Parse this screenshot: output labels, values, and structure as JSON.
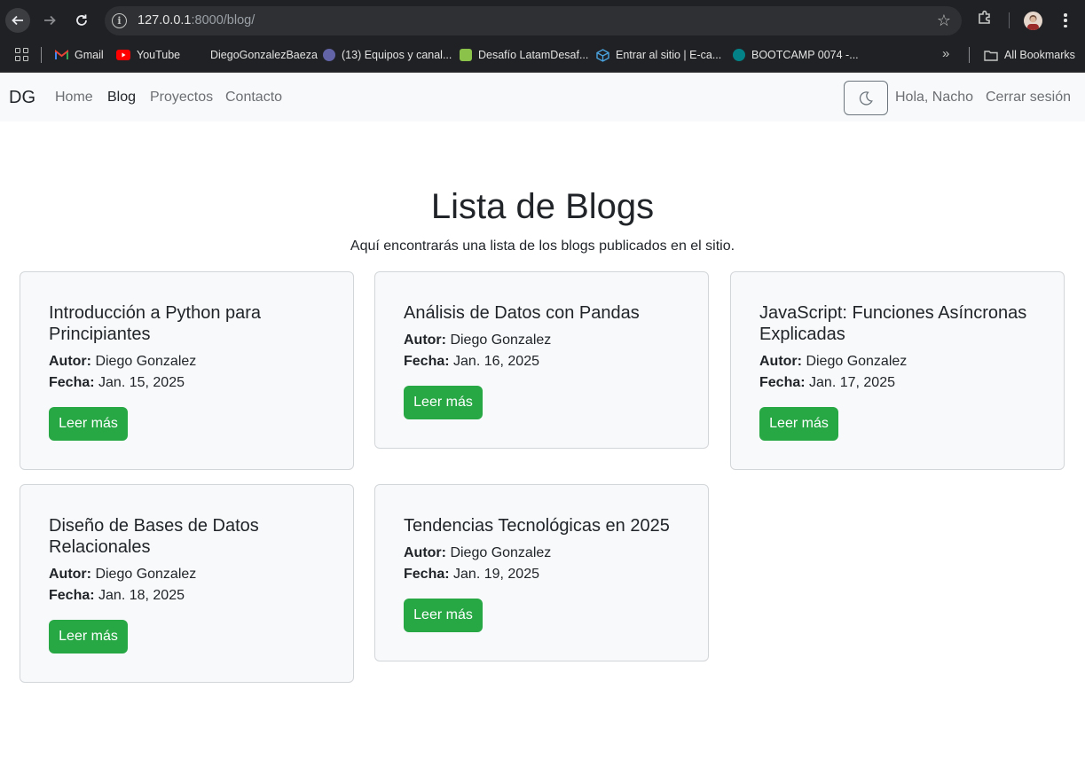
{
  "browser": {
    "url_host": "127.0.0.1",
    "url_rest": ":8000/blog/",
    "bookmarks": [
      {
        "label": "Gmail",
        "icon": "gmail-icon",
        "color": "#ea4335"
      },
      {
        "label": "YouTube",
        "icon": "youtube-icon",
        "color": "#ff0000"
      },
      {
        "label": "DiegoGonzalezBaeza",
        "icon": "",
        "color": ""
      },
      {
        "label": "(13) Equipos y canal...",
        "icon": "teams-icon",
        "color": "#6264a7"
      },
      {
        "label": "Desafío LatamDesaf...",
        "icon": "desafio-icon",
        "color": "#8bc34a"
      },
      {
        "label": "Entrar al sitio | E-ca...",
        "icon": "cube-icon",
        "color": "#4aa3df"
      },
      {
        "label": "BOOTCAMP 0074 -...",
        "icon": "sharepoint-icon",
        "color": "#038387"
      }
    ],
    "all_bookmarks_label": "All Bookmarks"
  },
  "nav": {
    "brand": "DG",
    "links": [
      "Home",
      "Blog",
      "Proyectos",
      "Contacto"
    ],
    "active": "Blog",
    "greeting": "Hola, Nacho",
    "logout": "Cerrar sesión"
  },
  "main": {
    "title": "Lista de Blogs",
    "subtitle": "Aquí encontrarás una lista de los blogs publicados en el sitio.",
    "author_label": "Autor:",
    "date_label": "Fecha:",
    "read_more": "Leer más",
    "posts": [
      {
        "title": "Introducción a Python para Principiantes",
        "author": "Diego Gonzalez",
        "date": "Jan. 15, 2025"
      },
      {
        "title": "Análisis de Datos con Pandas",
        "author": "Diego Gonzalez",
        "date": "Jan. 16, 2025"
      },
      {
        "title": "JavaScript: Funciones Asíncronas Explicadas",
        "author": "Diego Gonzalez",
        "date": "Jan. 17, 2025"
      },
      {
        "title": "Diseño de Bases de Datos Relacionales",
        "author": "Diego Gonzalez",
        "date": "Jan. 18, 2025"
      },
      {
        "title": "Tendencias Tecnológicas en 2025",
        "author": "Diego Gonzalez",
        "date": "Jan. 19, 2025"
      }
    ]
  },
  "colors": {
    "accent_button": "#28a745",
    "navbar_bg": "#f8f9fa",
    "card_bg": "#f8f9fa"
  }
}
